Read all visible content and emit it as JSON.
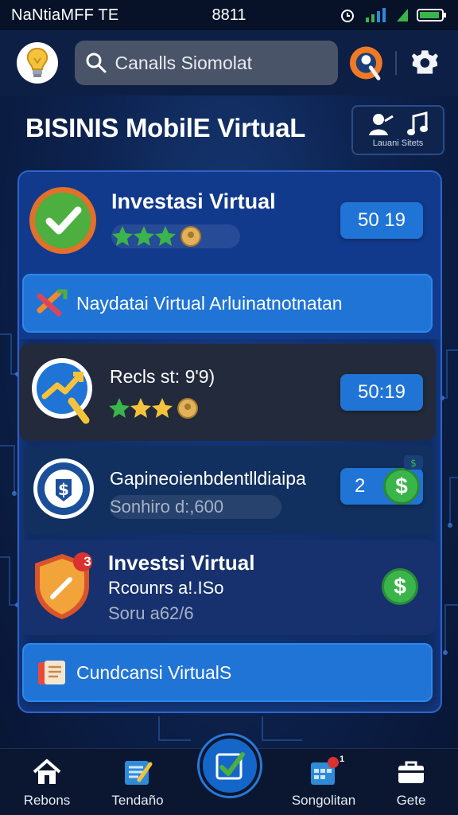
{
  "status_bar": {
    "carrier": "NaNtiaMFF TE",
    "time": "8811"
  },
  "app_bar": {
    "search_value": "Canalls Siomolat",
    "icons": [
      "lightbulb-icon",
      "search-icon",
      "avatar",
      "gear-icon"
    ]
  },
  "page": {
    "title": "BISINIS MobilE VirtuaL",
    "title_icon_caption": "Lauani Sitets"
  },
  "cards": [
    {
      "title": "Investasi Virtual",
      "value": "50 19",
      "rating": 3,
      "icon": "check-badge-icon"
    },
    {
      "title": "Recls st: 9'9)",
      "value": "50:19",
      "rating": 3,
      "icon": "growth-chart-icon"
    },
    {
      "title": "Gapineoienbdentlldiaipa",
      "subtitle": "Sonhiro d:,600",
      "value": "2",
      "icon": "dollar-shield-icon"
    },
    {
      "title": "Investsi Virtual",
      "subtitle": "Rcounrs a!.ISo",
      "muted": "Soru a62/6",
      "badge": "3",
      "icon": "shield-icon"
    }
  ],
  "buttons": {
    "primary": "Naydatai Virtual Arluinatnotnatan",
    "secondary": "Cundcansi VirtualS"
  },
  "bottom_nav": [
    {
      "label": "Rebons",
      "icon": "home-icon"
    },
    {
      "label": "Tendaño",
      "icon": "edit-board-icon"
    },
    {
      "label": "",
      "icon": "check-edit-icon"
    },
    {
      "label": "Songolitan",
      "icon": "calendar-icon",
      "badge": "1"
    },
    {
      "label": "Gete",
      "icon": "briefcase-icon"
    }
  ],
  "colors": {
    "accent": "#1f74d6",
    "background": "#0d2350",
    "success": "#3ab54a",
    "warning": "#f2a33a"
  }
}
